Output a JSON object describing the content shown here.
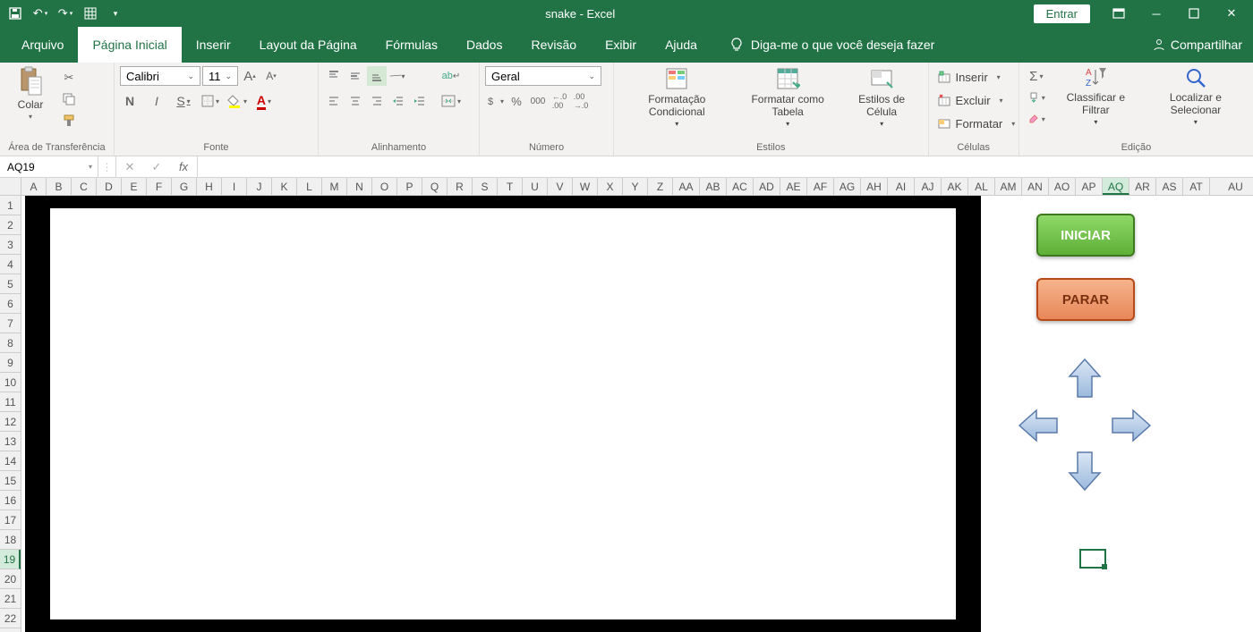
{
  "title": "snake  -  Excel",
  "signin": "Entrar",
  "tabs": {
    "file": "Arquivo",
    "home": "Página Inicial",
    "insert": "Inserir",
    "layout": "Layout da Página",
    "formulas": "Fórmulas",
    "data": "Dados",
    "review": "Revisão",
    "view": "Exibir",
    "help": "Ajuda",
    "tellme": "Diga-me o que você deseja fazer",
    "share": "Compartilhar"
  },
  "ribbon": {
    "clipboard": {
      "paste": "Colar",
      "label": "Área de Transferência"
    },
    "font": {
      "name": "Calibri",
      "size": "11",
      "bold": "N",
      "italic": "I",
      "underline": "S",
      "label": "Fonte"
    },
    "alignment": {
      "wrap": "ab",
      "label": "Alinhamento"
    },
    "number": {
      "format": "Geral",
      "label": "Número"
    },
    "styles": {
      "conditional": "Formatação Condicional",
      "table": "Formatar como Tabela",
      "cell": "Estilos de Célula",
      "label": "Estilos"
    },
    "cells": {
      "insert": "Inserir",
      "delete": "Excluir",
      "format": "Formatar",
      "label": "Células"
    },
    "editing": {
      "sort": "Classificar e Filtrar",
      "find": "Localizar e Selecionar",
      "label": "Edição"
    }
  },
  "namebox": "AQ19",
  "columns": [
    "A",
    "B",
    "C",
    "D",
    "E",
    "F",
    "G",
    "H",
    "I",
    "J",
    "K",
    "L",
    "M",
    "N",
    "O",
    "P",
    "Q",
    "R",
    "S",
    "T",
    "U",
    "V",
    "W",
    "X",
    "Y",
    "Z",
    "AA",
    "AB",
    "AC",
    "AD",
    "AE",
    "AF",
    "AG",
    "AH",
    "AI",
    "AJ",
    "AK",
    "AL",
    "AM",
    "AN",
    "AO",
    "AP",
    "AQ",
    "AR",
    "AS",
    "AT",
    "AU"
  ],
  "rows": [
    "1",
    "2",
    "3",
    "4",
    "5",
    "6",
    "7",
    "8",
    "9",
    "10",
    "11",
    "12",
    "13",
    "14",
    "15",
    "16",
    "17",
    "18",
    "19",
    "20",
    "21",
    "22"
  ],
  "selected_col": "AQ",
  "selected_row": "19",
  "game": {
    "start": "INICIAR",
    "stop": "PARAR"
  }
}
